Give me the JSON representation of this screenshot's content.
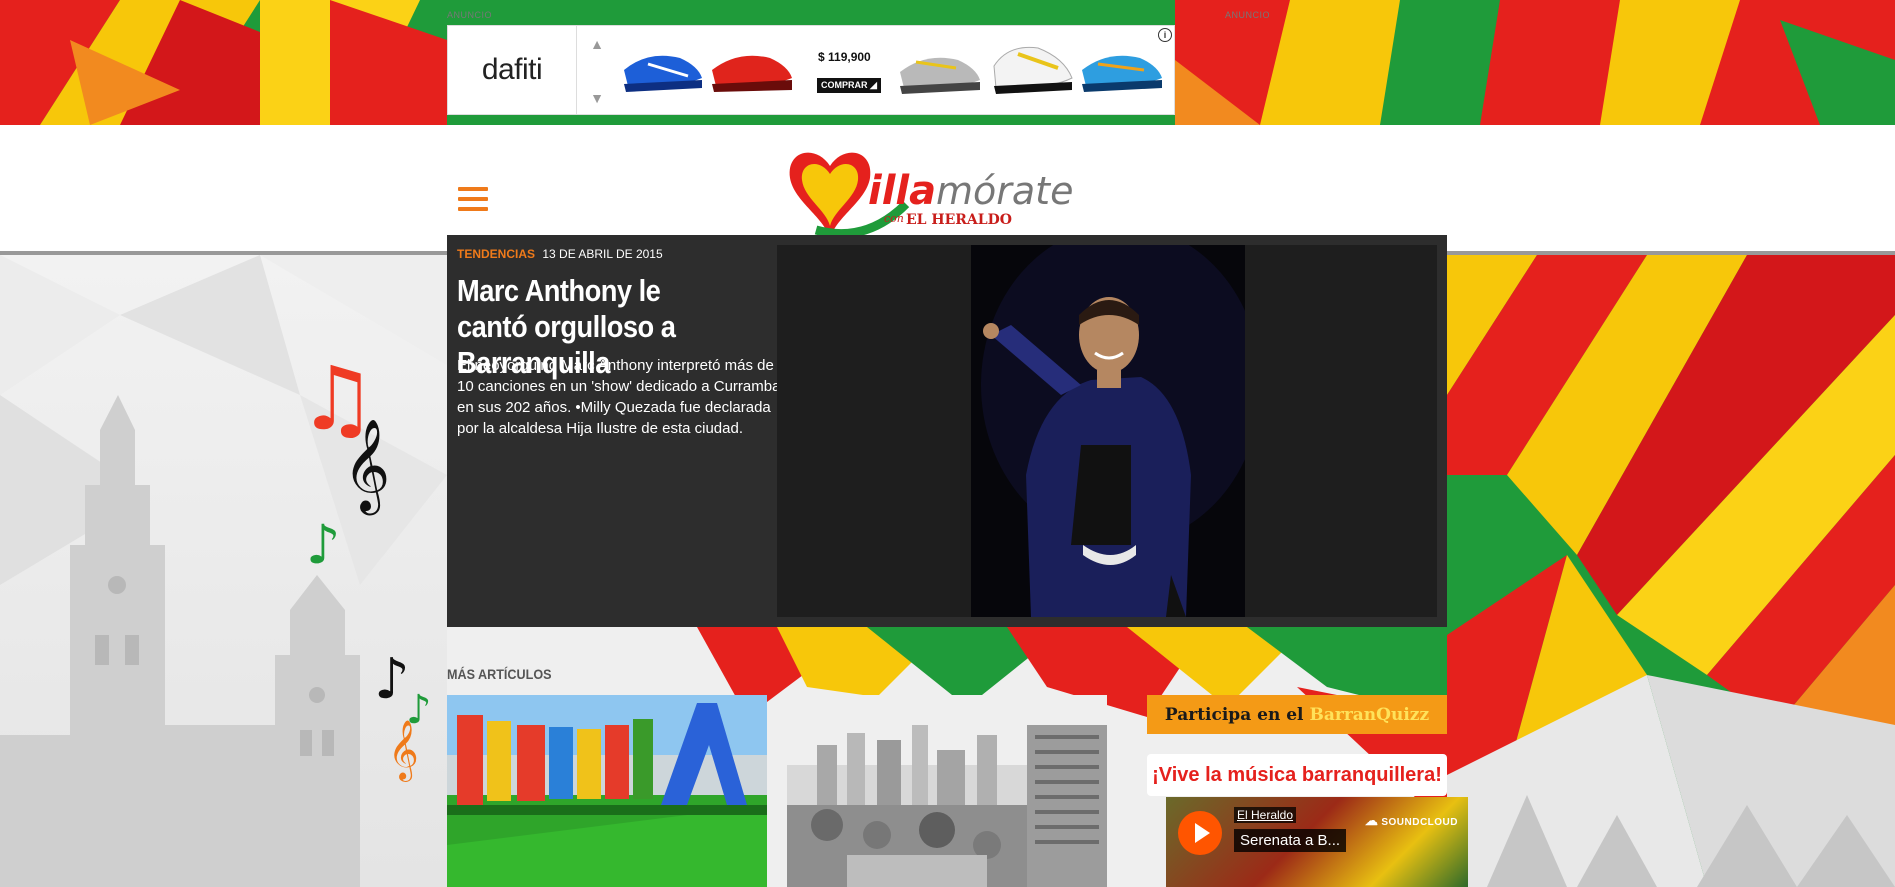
{
  "ad": {
    "tag_left": "ANUNCIO",
    "tag_right": "ANUNCIO",
    "brand": "dafiti",
    "price": "$ 119,900",
    "buy_label": "COMPRAR",
    "info_icon": "info-icon"
  },
  "header": {
    "menu_icon": "hamburger-icon",
    "logo": {
      "brand": "Quillamórate",
      "sub_prefix": "con",
      "sub_name": "EL HERALDO"
    }
  },
  "featured": {
    "category": "TENDENCIAS",
    "date": "13 DE ABRIL DE 2015",
    "title": "Marc Anthony le cantó orgulloso a Barranquilla",
    "summary": "El neoyorquino Marc Anthony interpretó más de 10 canciones en un 'show' dedicado a Curramba en sus 202 años. •Milly Quezada fue declarada por la alcaldesa Hija Ilustre de esta ciudad."
  },
  "more": {
    "label": "MÁS ARTÍCULOS"
  },
  "sidebar": {
    "quiz_prefix": "Participa en el",
    "quiz_highlight": "BarranQuizz",
    "vive_label": "¡Vive la música barranquillera!",
    "player": {
      "user": "El Heraldo",
      "track": "Serenata a B...",
      "brand": "SOUNDCLOUD"
    }
  },
  "colors": {
    "accent": "#ef7a1a",
    "red": "#e5211d",
    "green": "#1f9b3a",
    "yellow": "#f7c70a"
  }
}
